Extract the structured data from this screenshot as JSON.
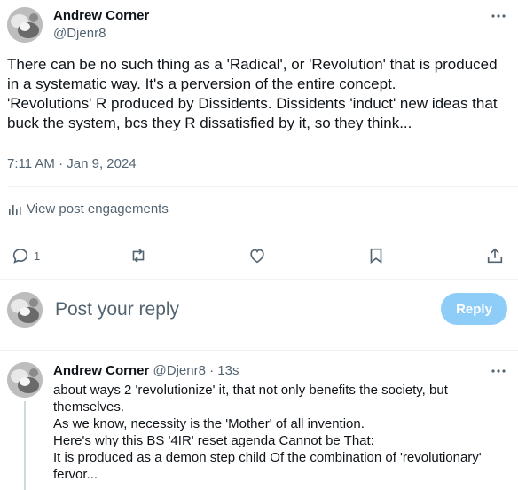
{
  "post": {
    "author_name": "Andrew Corner",
    "author_handle": "@Djenr8",
    "more_icon": "more-horizontal-icon",
    "text": "There can be no such thing as a 'Radical', or 'Revolution' that is produced in a systematic way. It's a perversion of the entire concept.\n'Revolutions' R produced by Dissidents. Dissidents 'induct' new ideas that buck the system, bcs they R dissatisfied by it, so they think...",
    "timestamp": "7:11 AM · Jan 9, 2024",
    "engagements_label": "View post engagements",
    "actions": {
      "reply_count": "1",
      "reply_icon": "reply-icon",
      "repost_icon": "repost-icon",
      "like_icon": "heart-icon",
      "bookmark_icon": "bookmark-icon",
      "share_icon": "share-icon"
    }
  },
  "composer": {
    "placeholder": "Post your reply",
    "button_label": "Reply"
  },
  "reply": {
    "author_name": "Andrew Corner",
    "meta": "@Djenr8 · 13s",
    "text": "about ways 2 'revolutionize' it, that not only benefits the society, but themselves.\nAs we know, necessity is the 'Mother' of all invention.\nHere's why this BS '4IR' reset agenda Cannot be That:\nIt is produced as a demon step child Of the combination of 'revolutionary' fervor..."
  },
  "colors": {
    "text_primary": "#0f1419",
    "text_secondary": "#536471",
    "reply_button_bg": "#8ecdf8",
    "divider": "#eff3f4"
  }
}
